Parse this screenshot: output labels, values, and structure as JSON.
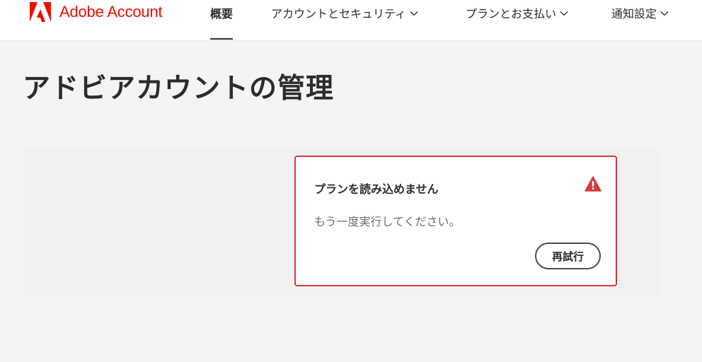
{
  "header": {
    "brand_name": "Adobe Account",
    "logo_icon": "adobe-logo-icon",
    "brand_color": "#eb1000",
    "nav": [
      {
        "label": "概要",
        "active": true,
        "has_dropdown": false
      },
      {
        "label": "アカウントとセキュリティ",
        "active": false,
        "has_dropdown": true
      },
      {
        "label": "プランとお支払い",
        "active": false,
        "has_dropdown": true
      },
      {
        "label": "通知設定",
        "active": false,
        "has_dropdown": true
      }
    ],
    "dropdown_icon": "chevron-down-icon"
  },
  "main": {
    "title": "アドビアカウントの管理"
  },
  "error_card": {
    "title": "プランを読み込めません",
    "message": "もう一度実行してください。",
    "retry_label": "再試行",
    "alert_icon": "alert-triangle-icon",
    "accent_color": "#d7373f"
  }
}
